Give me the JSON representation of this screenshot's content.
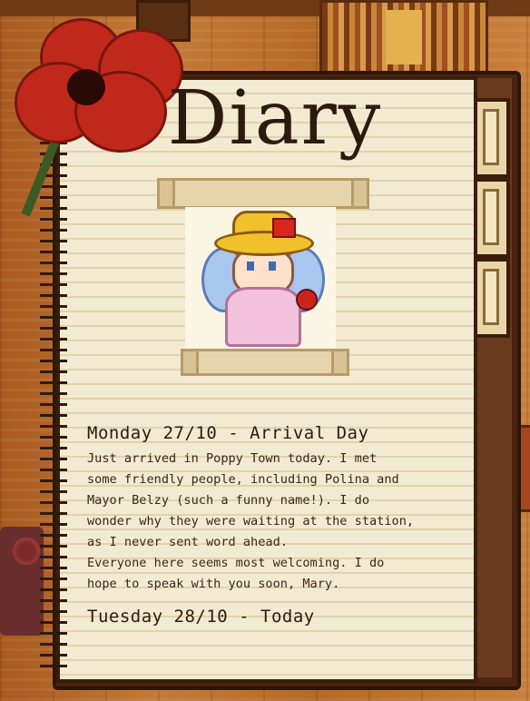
{
  "title": "Diary",
  "entries": [
    {
      "date": "Monday 27/10 - Arrival Day",
      "body": "Just arrived in Poppy Town today. I met\nsome friendly people, including Polina and\nMayor Belzy (such a funny name!). I do\nwonder why they were waiting at the station,\nas I never sent word ahead.\nEveryone here seems most welcoming. I do\nhope to speak with you soon, Mary."
    },
    {
      "date": "Tuesday 28/10 - Today",
      "body": ""
    }
  ],
  "colors": {
    "page": "#f3ead2",
    "ink": "#2c1a0e",
    "poppy": "#c0281c",
    "cover": "#4a2410"
  },
  "icons": [
    "poppy-flower-icon",
    "character-portrait",
    "bookmark-tab-icon"
  ]
}
